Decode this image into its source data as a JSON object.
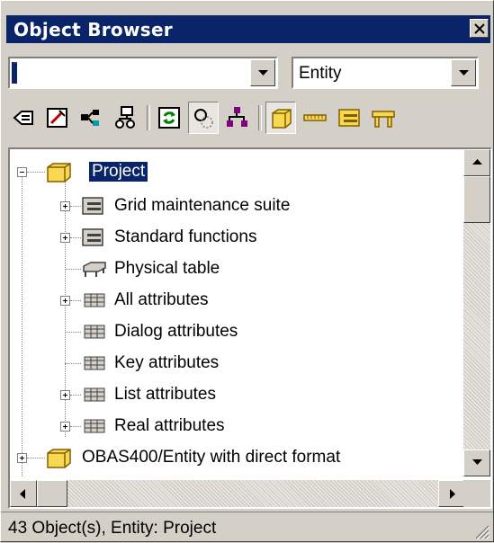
{
  "window": {
    "title": "Object Browser"
  },
  "filter": {
    "value": "*"
  },
  "type_select": {
    "value": "Entity"
  },
  "toolbar": {
    "buttons": [
      "back-icon",
      "wizard-icon",
      "hierarchy-icon",
      "network-icon",
      "refresh-icon",
      "circles-icon",
      "relations-icon",
      "entity-icon",
      "field-icon",
      "function-icon",
      "table-icon"
    ]
  },
  "tree": {
    "root": {
      "label": "Project"
    },
    "children": [
      {
        "label": "Grid maintenance suite",
        "icon": "function-icon",
        "expander": "+"
      },
      {
        "label": "Standard functions",
        "icon": "function-icon",
        "expander": "+"
      },
      {
        "label": "Physical table",
        "icon": "physical-table-icon",
        "expander": ""
      },
      {
        "label": "All attributes",
        "icon": "attributes-icon",
        "expander": "+"
      },
      {
        "label": "Dialog attributes",
        "icon": "attributes-icon",
        "expander": ""
      },
      {
        "label": "Key attributes",
        "icon": "attributes-icon",
        "expander": ""
      },
      {
        "label": "List attributes",
        "icon": "attributes-icon",
        "expander": "+"
      },
      {
        "label": "Real attributes",
        "icon": "attributes-icon",
        "expander": "+"
      }
    ],
    "next_root": {
      "label": "OBAS400/Entity with direct format"
    }
  },
  "status": {
    "text": "43 Object(s), Entity: Project"
  },
  "colors": {
    "title_bar": "#0a246a",
    "face": "#d4d0c8",
    "selection": "#0a246a"
  }
}
